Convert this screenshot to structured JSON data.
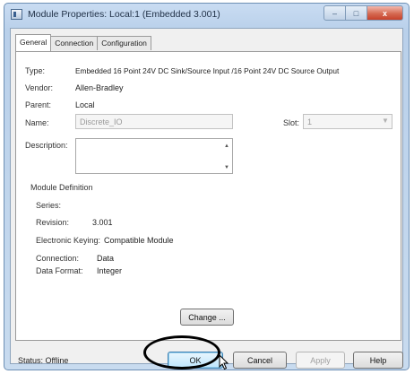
{
  "window": {
    "title": "Module Properties: Local:1 (Embedded 3.001)",
    "caption_buttons": {
      "minimize": "–",
      "maximize": "□",
      "close": "x"
    }
  },
  "tabs": [
    {
      "label": "General",
      "active": true
    },
    {
      "label": "Connection",
      "active": false
    },
    {
      "label": "Configuration",
      "active": false
    }
  ],
  "general": {
    "type_label": "Type:",
    "type_value": "Embedded 16 Point 24V DC Sink/Source Input /16 Point 24V DC Source Output",
    "vendor_label": "Vendor:",
    "vendor_value": "Allen-Bradley",
    "parent_label": "Parent:",
    "parent_value": "Local",
    "name_label": "Name:",
    "name_value": "Discrete_IO",
    "slot_label": "Slot:",
    "slot_value": "1",
    "description_label": "Description:",
    "description_value": ""
  },
  "module_definition": {
    "heading": "Module Definition",
    "series_label": "Series:",
    "revision_label": "Revision:",
    "revision_value": "3.001",
    "keying_label": "Electronic Keying:",
    "keying_value": "Compatible Module",
    "connection_label": "Connection:",
    "connection_value": "Data",
    "data_format_label": "Data Format:",
    "data_format_value": "Integer",
    "change_button": "Change ..."
  },
  "footer": {
    "status": "Status:  Offline",
    "ok": "OK",
    "cancel": "Cancel",
    "apply": "Apply",
    "help": "Help"
  },
  "icons": [
    "module-icon",
    "mouse-pointer-icon"
  ],
  "colors": {
    "highlight_ellipse": "#000000",
    "title_bar": "#c9dcf2"
  }
}
